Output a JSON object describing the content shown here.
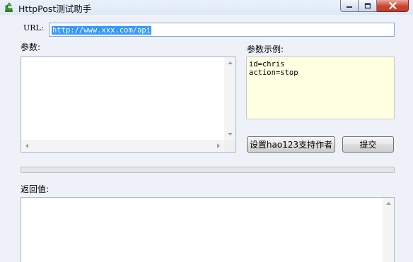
{
  "window": {
    "title": "HttpPost测试助手",
    "icons": [
      "app-icon",
      "minimize-icon",
      "maximize-icon",
      "close-icon"
    ]
  },
  "url": {
    "label": "URL:",
    "value": "http://www.xxx.com/api"
  },
  "params": {
    "label": "参数:",
    "value": ""
  },
  "example": {
    "label": "参数示例:",
    "content": "id=chris\naction=stop"
  },
  "buttons": {
    "support_label": "设置hao123支持作者",
    "submit_label": "提交"
  },
  "progress": {
    "value": 0
  },
  "result": {
    "label": "返回值:",
    "value": ""
  },
  "colors": {
    "selection": "#3399ff",
    "example_bg": "#ffffe1",
    "close_button": "#c8462f"
  }
}
